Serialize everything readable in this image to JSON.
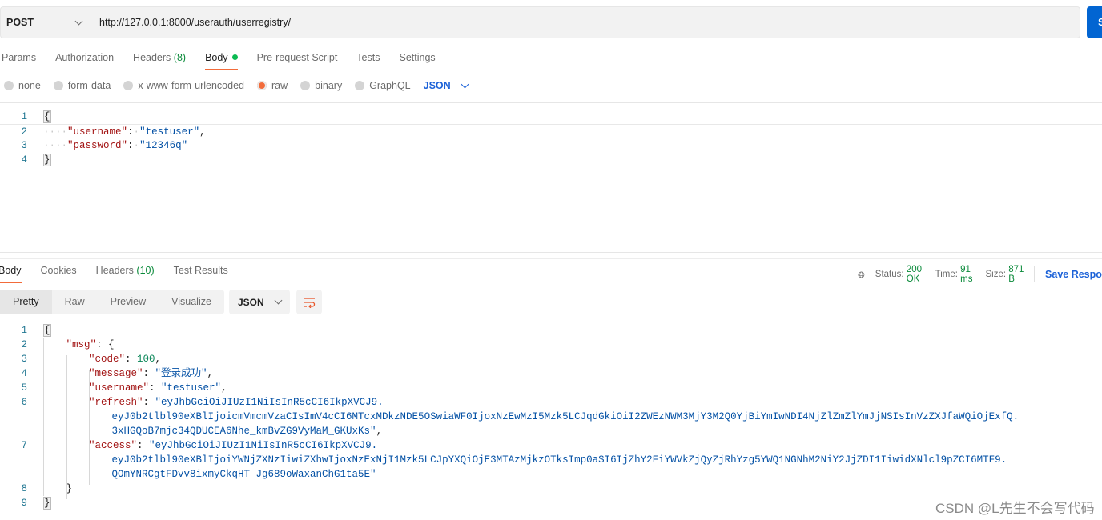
{
  "request": {
    "method": "POST",
    "url": "http://127.0.0.1:8000/userauth/userregistry/",
    "send_label": "Send",
    "tabs": [
      {
        "label": "Params"
      },
      {
        "label": "Authorization"
      },
      {
        "label": "Headers",
        "count": "(8)"
      },
      {
        "label": "Body",
        "active": true
      },
      {
        "label": "Pre-request Script"
      },
      {
        "label": "Tests"
      },
      {
        "label": "Settings"
      }
    ],
    "body_types": [
      {
        "label": "none"
      },
      {
        "label": "form-data"
      },
      {
        "label": "x-www-form-urlencoded"
      },
      {
        "label": "raw",
        "selected": true
      },
      {
        "label": "binary"
      },
      {
        "label": "GraphQL"
      }
    ],
    "format": "JSON",
    "code": [
      {
        "n": "1",
        "i": 0,
        "parts": [
          [
            "p",
            "{"
          ]
        ]
      },
      {
        "n": "2",
        "i": 0,
        "parts": [
          [
            "ws",
            "····"
          ],
          [
            "k",
            "\"username\""
          ],
          [
            "p",
            ":"
          ],
          [
            "ws",
            "·"
          ],
          [
            "s",
            "\"testuser\""
          ],
          [
            "p",
            ","
          ]
        ]
      },
      {
        "n": "3",
        "i": 0,
        "parts": [
          [
            "ws",
            "····"
          ],
          [
            "k",
            "\"password\""
          ],
          [
            "p",
            ":"
          ],
          [
            "ws",
            "·"
          ],
          [
            "s",
            "\"12346q\""
          ]
        ]
      },
      {
        "n": "4",
        "i": 0,
        "parts": [
          [
            "p",
            "}"
          ]
        ]
      }
    ]
  },
  "response": {
    "tabs": [
      {
        "label": "Body",
        "active": true
      },
      {
        "label": "Cookies"
      },
      {
        "label": "Headers",
        "count": "(10)"
      },
      {
        "label": "Test Results"
      }
    ],
    "status_label": "Status:",
    "status": "200 OK",
    "time_label": "Time:",
    "time": "91 ms",
    "size_label": "Size:",
    "size": "871 B",
    "save_label": "Save Response",
    "views": [
      {
        "label": "Pretty",
        "active": true
      },
      {
        "label": "Raw"
      },
      {
        "label": "Preview"
      },
      {
        "label": "Visualize"
      }
    ],
    "format": "JSON",
    "code": [
      {
        "n": "1",
        "i": 0,
        "parts": [
          [
            "p",
            "{"
          ]
        ]
      },
      {
        "n": "2",
        "i": 1,
        "parts": [
          [
            "k",
            "\"msg\""
          ],
          [
            "p",
            ": {"
          ]
        ]
      },
      {
        "n": "3",
        "i": 2,
        "parts": [
          [
            "k",
            "\"code\""
          ],
          [
            "p",
            ": "
          ],
          [
            "n",
            "100"
          ],
          [
            "p",
            ","
          ]
        ]
      },
      {
        "n": "4",
        "i": 2,
        "parts": [
          [
            "k",
            "\"message\""
          ],
          [
            "p",
            ": "
          ],
          [
            "s",
            "\"登录成功\""
          ],
          [
            "p",
            ","
          ]
        ]
      },
      {
        "n": "5",
        "i": 2,
        "parts": [
          [
            "k",
            "\"username\""
          ],
          [
            "p",
            ": "
          ],
          [
            "s",
            "\"testuser\""
          ],
          [
            "p",
            ","
          ]
        ]
      },
      {
        "n": "6",
        "i": 2,
        "parts": [
          [
            "k",
            "\"refresh\""
          ],
          [
            "p",
            ": "
          ],
          [
            "s",
            "\"eyJhbGciOiJIUzI1NiIsInR5cCI6IkpXVCJ9."
          ]
        ]
      },
      {
        "n": "",
        "i": 3,
        "parts": [
          [
            "s",
            "eyJ0b2tlbl90eXBlIjoicmVmcmVzaCIsImV4cCI6MTcxMDkzNDE5OSwiaWF0IjoxNzEwMzI5Mzk5LCJqdGkiOiI2ZWEzNWM3MjY3M2Q0YjBiYmIwNDI4NjZlZmZlYmJjNSIsInVzZXJfaWQiOjExfQ."
          ]
        ]
      },
      {
        "n": "",
        "i": 3,
        "parts": [
          [
            "s",
            "3xHGQoB7mjc34QDUCEA6Nhe_kmBvZG9VyMaM_GKUxKs\""
          ],
          [
            "p",
            ","
          ]
        ]
      },
      {
        "n": "7",
        "i": 2,
        "parts": [
          [
            "k",
            "\"access\""
          ],
          [
            "p",
            ": "
          ],
          [
            "s",
            "\"eyJhbGciOiJIUzI1NiIsInR5cCI6IkpXVCJ9."
          ]
        ]
      },
      {
        "n": "",
        "i": 3,
        "parts": [
          [
            "s",
            "eyJ0b2tlbl90eXBlIjoiYWNjZXNzIiwiZXhwIjoxNzExNjI1Mzk5LCJpYXQiOjE3MTAzMjkzOTksImp0aSI6IjZhY2FiYWVkZjQyZjRhYzg5YWQ1NGNhM2NiY2JjZDI1IiwidXNlcl9pZCI6MTF9."
          ]
        ]
      },
      {
        "n": "",
        "i": 3,
        "parts": [
          [
            "s",
            "QOmYNRCgtFDvv8ixmyCkqHT_Jg689oWaxanChG1ta5E\""
          ]
        ]
      },
      {
        "n": "8",
        "i": 1,
        "parts": [
          [
            "p",
            "}"
          ]
        ]
      },
      {
        "n": "9",
        "i": 0,
        "parts": [
          [
            "p",
            "}"
          ]
        ]
      }
    ]
  },
  "watermark": "CSDN @L先生不会写代码"
}
